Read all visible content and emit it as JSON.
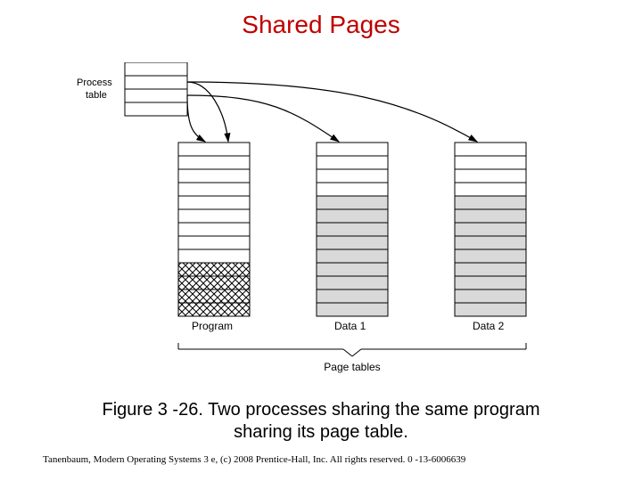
{
  "title": "Shared Pages",
  "caption_line1": "Figure 3 -26. Two processes sharing the same program",
  "caption_line2": "sharing its page table.",
  "credit": "Tanenbaum, Modern Operating Systems 3 e, (c) 2008 Prentice-Hall, Inc. All rights reserved. 0 -13-6006639",
  "labels": {
    "process_table1": "Process",
    "process_table2": "table",
    "program": "Program",
    "data1": "Data 1",
    "data2": "Data 2",
    "page_tables": "Page tables"
  }
}
